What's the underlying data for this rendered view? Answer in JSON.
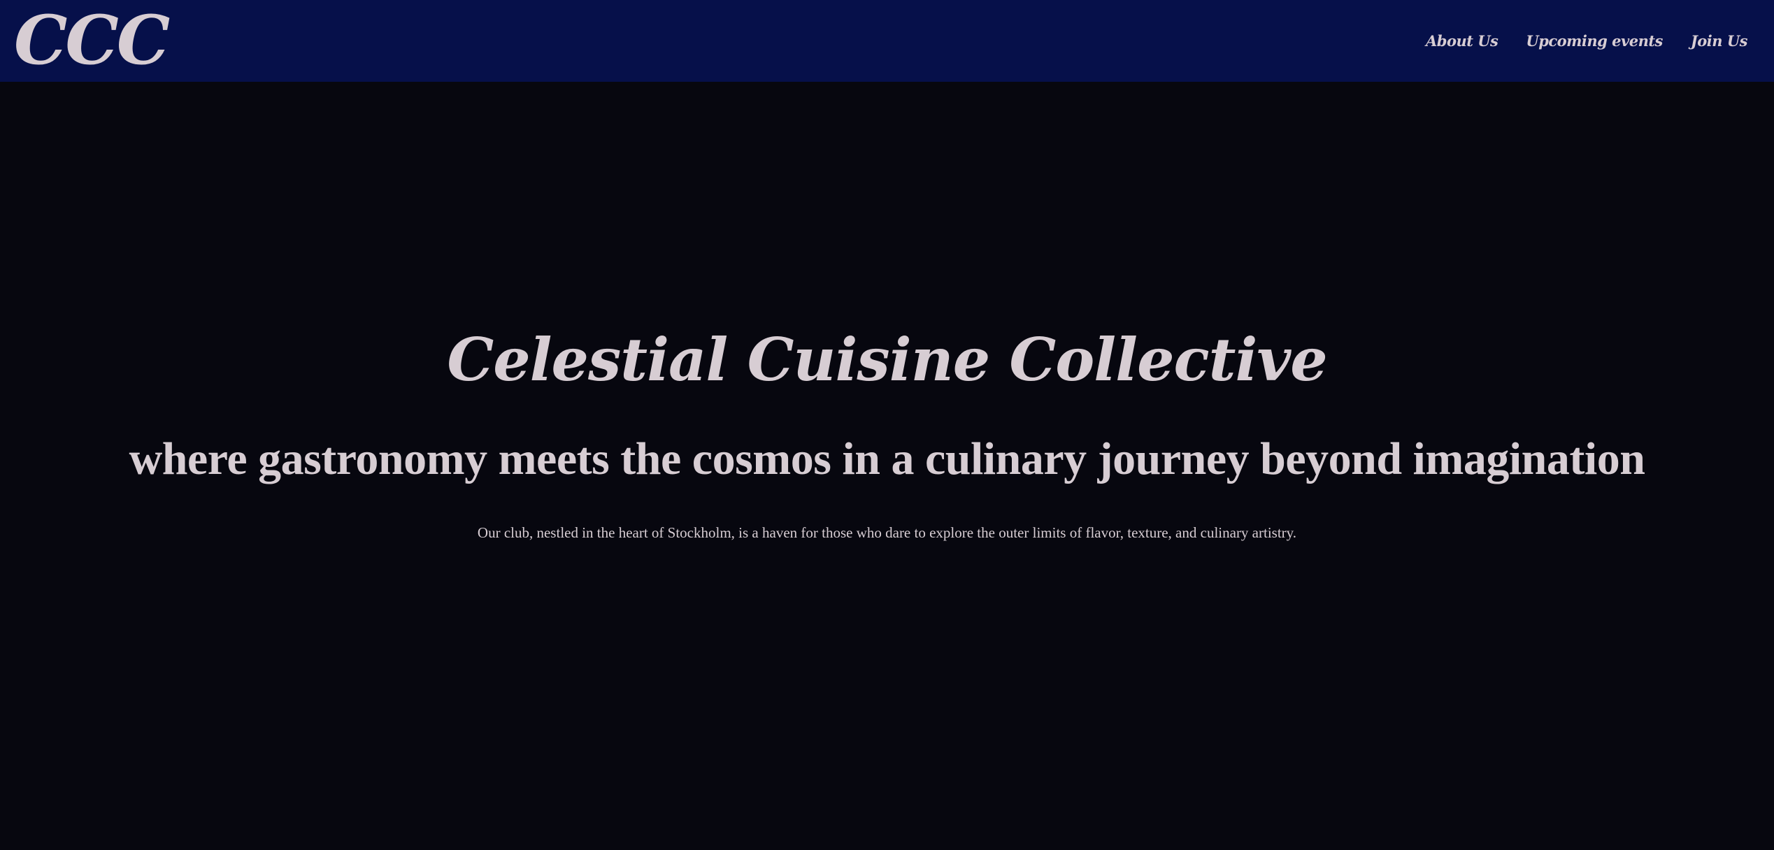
{
  "header": {
    "logo": "CCC",
    "nav": [
      {
        "label": "About Us"
      },
      {
        "label": "Upcoming events"
      },
      {
        "label": "Join Us"
      }
    ]
  },
  "hero": {
    "title": "Celestial Cuisine Collective",
    "subtitle": "where gastronomy meets the cosmos in a culinary journey beyond imagination",
    "text": "Our club, nestled in the heart of Stockholm, is a haven for those who dare to explore the outer limits of flavor, texture, and culinary artistry."
  },
  "colors": {
    "header_bg": "#06104a",
    "page_bg": "#07070f",
    "text": "#d7cdd3"
  }
}
